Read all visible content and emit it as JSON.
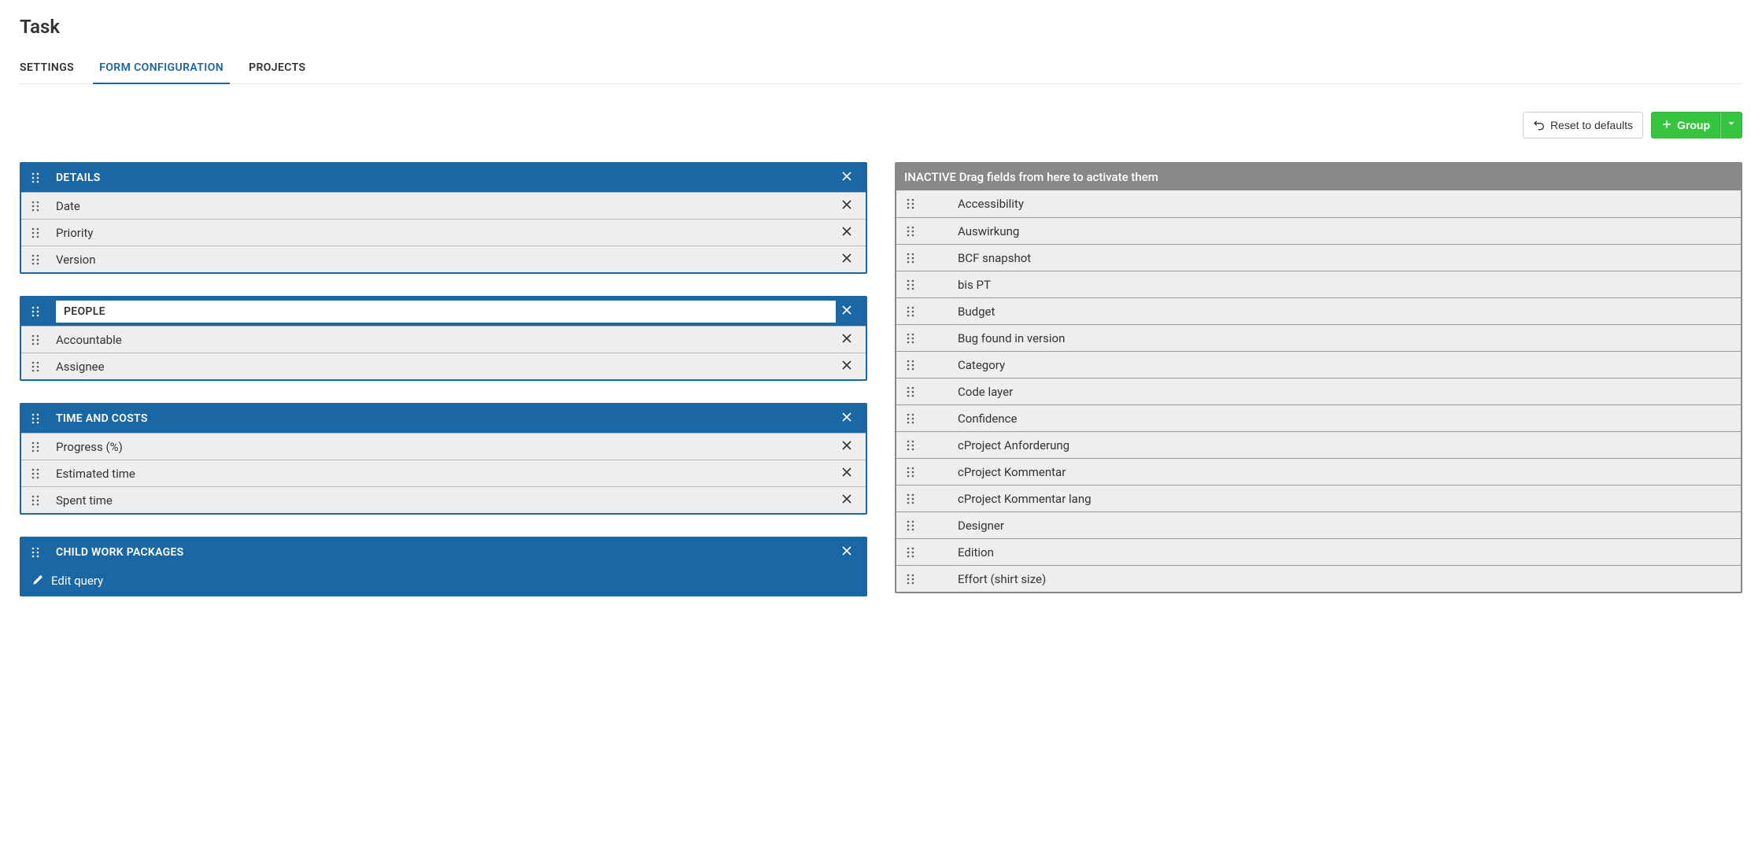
{
  "page": {
    "title": "Task"
  },
  "tabs": [
    {
      "id": "settings",
      "label": "SETTINGS",
      "active": false
    },
    {
      "id": "form-configuration",
      "label": "FORM CONFIGURATION",
      "active": true
    },
    {
      "id": "projects",
      "label": "PROJECTS",
      "active": false
    }
  ],
  "toolbar": {
    "reset_label": "Reset to defaults",
    "group_label": "Group"
  },
  "groups": [
    {
      "id": "details",
      "title": "DETAILS",
      "editing": false,
      "fields": [
        {
          "label": "Date"
        },
        {
          "label": "Priority"
        },
        {
          "label": "Version"
        }
      ]
    },
    {
      "id": "people",
      "title": "PEOPLE",
      "editing": true,
      "fields": [
        {
          "label": "Accountable"
        },
        {
          "label": "Assignee"
        }
      ]
    },
    {
      "id": "time-costs",
      "title": "TIME AND COSTS",
      "editing": false,
      "fields": [
        {
          "label": "Progress (%)"
        },
        {
          "label": "Estimated time"
        },
        {
          "label": "Spent time"
        }
      ]
    },
    {
      "id": "child-wp",
      "title": "CHILD WORK PACKAGES",
      "editing": false,
      "fields": [],
      "footer_action": "Edit query"
    }
  ],
  "inactive": {
    "header": "INACTIVE Drag fields from here to activate them",
    "fields": [
      {
        "label": "Accessibility"
      },
      {
        "label": "Auswirkung"
      },
      {
        "label": "BCF snapshot"
      },
      {
        "label": "bis PT"
      },
      {
        "label": "Budget"
      },
      {
        "label": "Bug found in version"
      },
      {
        "label": "Category"
      },
      {
        "label": "Code layer"
      },
      {
        "label": "Confidence"
      },
      {
        "label": "cProject Anforderung"
      },
      {
        "label": "cProject Kommentar"
      },
      {
        "label": "cProject Kommentar lang"
      },
      {
        "label": "Designer"
      },
      {
        "label": "Edition"
      },
      {
        "label": "Effort (shirt size)"
      }
    ]
  }
}
